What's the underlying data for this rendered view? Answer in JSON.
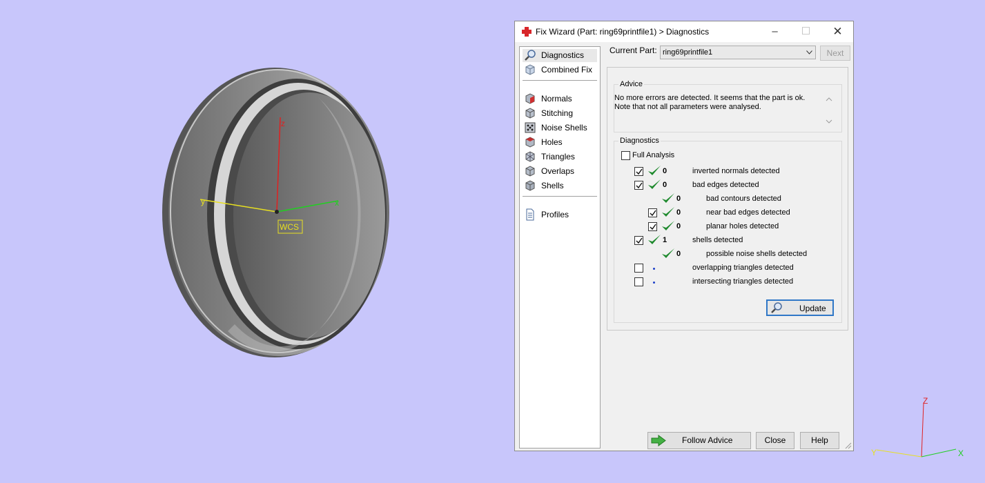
{
  "viewport": {
    "wcs_label": "WCS",
    "axis_z": "z",
    "axis_y": "y",
    "axis_x": "x",
    "mini_axis_z": "Z",
    "mini_axis_y": "Y",
    "mini_axis_x": "X",
    "background_color": "#c8c6fb"
  },
  "dialog": {
    "title": "Fix Wizard (Part: ring69printfile1) > Diagnostics",
    "nav": {
      "group1": [
        {
          "label": "Diagnostics",
          "icon": "magnifier-icon",
          "selected": true
        },
        {
          "label": "Combined Fix",
          "icon": "cube-icon"
        }
      ],
      "group2": [
        {
          "label": "Normals",
          "icon": "normals-cube-icon"
        },
        {
          "label": "Stitching",
          "icon": "stitching-cube-icon"
        },
        {
          "label": "Noise Shells",
          "icon": "noise-shells-icon"
        },
        {
          "label": "Holes",
          "icon": "holes-cube-icon"
        },
        {
          "label": "Triangles",
          "icon": "triangles-cube-icon"
        },
        {
          "label": "Overlaps",
          "icon": "overlaps-cube-icon"
        },
        {
          "label": "Shells",
          "icon": "shells-cube-icon"
        }
      ],
      "group3": [
        {
          "label": "Profiles",
          "icon": "document-icon"
        }
      ]
    },
    "current_part_label": "Current Part:",
    "current_part_value": "ring69printfile1",
    "next_label": "Next",
    "advice_title": "Advice",
    "advice_line1": "No more errors are detected. It seems that the part is ok.",
    "advice_line2": "Note that not all parameters were analysed.",
    "diagnostics_title": "Diagnostics",
    "full_analysis_label": "Full Analysis",
    "rows": [
      {
        "checkbox": true,
        "checked": true,
        "status": "ok",
        "value": "0",
        "label": "inverted normals detected",
        "indent": 0
      },
      {
        "checkbox": true,
        "checked": true,
        "status": "ok",
        "value": "0",
        "label": "bad edges detected",
        "indent": 0
      },
      {
        "checkbox": false,
        "checked": false,
        "status": "ok",
        "value": "0",
        "label": "bad contours detected",
        "indent": 1
      },
      {
        "checkbox": true,
        "checked": true,
        "status": "ok",
        "value": "0",
        "label": "near bad edges detected",
        "indent": 1
      },
      {
        "checkbox": true,
        "checked": true,
        "status": "ok",
        "value": "0",
        "label": "planar holes detected",
        "indent": 1
      },
      {
        "checkbox": true,
        "checked": true,
        "status": "ok",
        "value": "1",
        "label": "shells detected",
        "indent": 0
      },
      {
        "checkbox": false,
        "checked": false,
        "status": "ok",
        "value": "0",
        "label": "possible noise shells detected",
        "indent": 1
      },
      {
        "checkbox": true,
        "checked": false,
        "status": "pending",
        "value": "",
        "label": "overlapping triangles detected",
        "indent": 0
      },
      {
        "checkbox": true,
        "checked": false,
        "status": "pending",
        "value": "",
        "label": "intersecting triangles detected",
        "indent": 0
      }
    ],
    "update_label": "Update",
    "follow_advice_label": "Follow Advice",
    "close_label": "Close",
    "help_label": "Help",
    "accent_color": "#2f77c7",
    "ok_color": "#1f8a2e"
  }
}
